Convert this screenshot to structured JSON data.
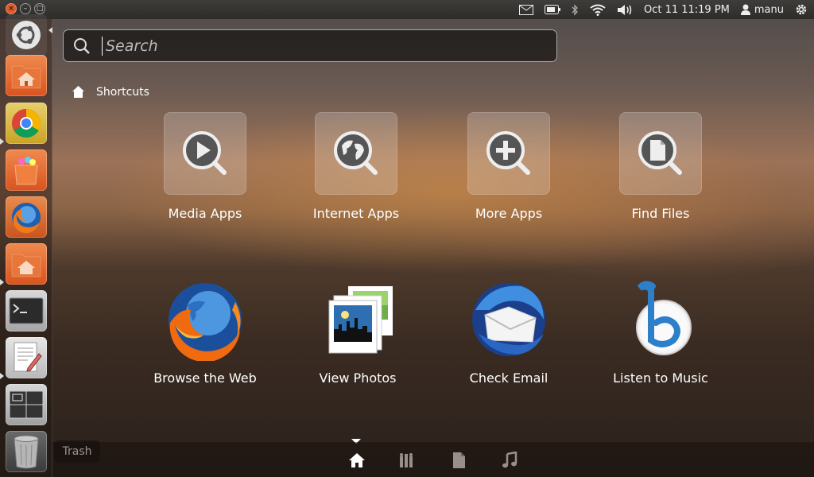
{
  "window_controls": {
    "close": "×",
    "minimize": "–",
    "maximize": "□"
  },
  "top_panel": {
    "datetime": "Oct 11 11:19 PM",
    "user": "manu",
    "icons": [
      "mail-icon",
      "battery-icon",
      "bluetooth-icon",
      "wifi-icon",
      "volume-icon",
      "user-icon",
      "session-gear-icon"
    ]
  },
  "launcher": {
    "items": [
      {
        "name": "ubuntu-dash-button"
      },
      {
        "name": "home-folder-launcher"
      },
      {
        "name": "chrome-launcher"
      },
      {
        "name": "software-center-launcher"
      },
      {
        "name": "firefox-launcher"
      },
      {
        "name": "files-launcher"
      },
      {
        "name": "terminal-launcher"
      },
      {
        "name": "text-editor-launcher"
      },
      {
        "name": "workspace-switcher-launcher"
      },
      {
        "name": "trash-launcher"
      }
    ],
    "trash_tooltip": "Trash"
  },
  "search": {
    "placeholder": "Search",
    "value": ""
  },
  "section": {
    "heading": "Shortcuts"
  },
  "shortcuts": [
    {
      "label": "Media Apps",
      "icon": "media-apps-icon"
    },
    {
      "label": "Internet Apps",
      "icon": "internet-apps-icon"
    },
    {
      "label": "More Apps",
      "icon": "more-apps-icon"
    },
    {
      "label": "Find Files",
      "icon": "find-files-icon"
    }
  ],
  "apps": [
    {
      "label": "Browse the Web",
      "icon": "firefox-icon"
    },
    {
      "label": "View Photos",
      "icon": "photos-icon"
    },
    {
      "label": "Check Email",
      "icon": "thunderbird-icon"
    },
    {
      "label": "Listen to Music",
      "icon": "banshee-icon"
    }
  ],
  "lens_bar": {
    "lenses": [
      "home-lens-icon",
      "applications-lens-icon",
      "files-lens-icon",
      "music-lens-icon"
    ],
    "active": "home-lens-icon"
  },
  "colors": {
    "accent": "#e05b2b",
    "panel": "#3c3a37"
  }
}
